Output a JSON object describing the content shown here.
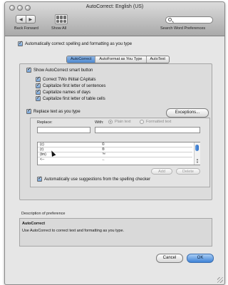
{
  "window": {
    "title": "AutoCorrect: English (US)"
  },
  "toolbar": {
    "nav_label": "Back  Forward",
    "back_icon": "◀",
    "forward_icon": "▶",
    "show_all_label": "Show All",
    "search_placeholder": "",
    "search_label": "Search Word Preferences"
  },
  "auto_correct_spelling": {
    "label": "Automatically correct spelling and formatting as you type",
    "checked": true
  },
  "tabs": [
    {
      "label": "AutoCorrect",
      "selected": true
    },
    {
      "label": "AutoFormat as You Type",
      "selected": false
    },
    {
      "label": "AutoText",
      "selected": false
    }
  ],
  "autocorrect": {
    "show_smart_button": {
      "label": "Show AutoCorrect smart button",
      "checked": true
    },
    "options": [
      {
        "label": "Correct TWo INitial CApitals",
        "checked": true
      },
      {
        "label": "Capitalize first letter of sentences",
        "checked": true
      },
      {
        "label": "Capitalize names of days",
        "checked": true
      },
      {
        "label": "Capitalize first letter of table cells",
        "checked": true
      }
    ],
    "replace_text": {
      "label": "Replace text as you type",
      "checked": true
    },
    "exceptions_button": "Exceptions...",
    "replace_label": "Replace:",
    "with_label": "With:",
    "replace_value": "",
    "with_value": "",
    "plain_text_label": "Plain text",
    "formatted_text_label": "Formatted text",
    "entries": [
      {
        "replace": "(c)",
        "with": "©"
      },
      {
        "replace": "(r)",
        "with": "®"
      },
      {
        "replace": "(tm)",
        "with": "™"
      },
      {
        "replace": "<--",
        "with": "←"
      }
    ],
    "add_button": "Add",
    "delete_button": "Delete",
    "use_suggestions": {
      "label": "Automatically use suggestions from the spelling checker",
      "checked": true
    }
  },
  "description": {
    "header": "Description of preference",
    "title": "AutoCorrect",
    "text": "Use AutoCorrect to correct text and formatting as you type."
  },
  "footer": {
    "cancel_label": "Cancel",
    "ok_label": "OK"
  }
}
